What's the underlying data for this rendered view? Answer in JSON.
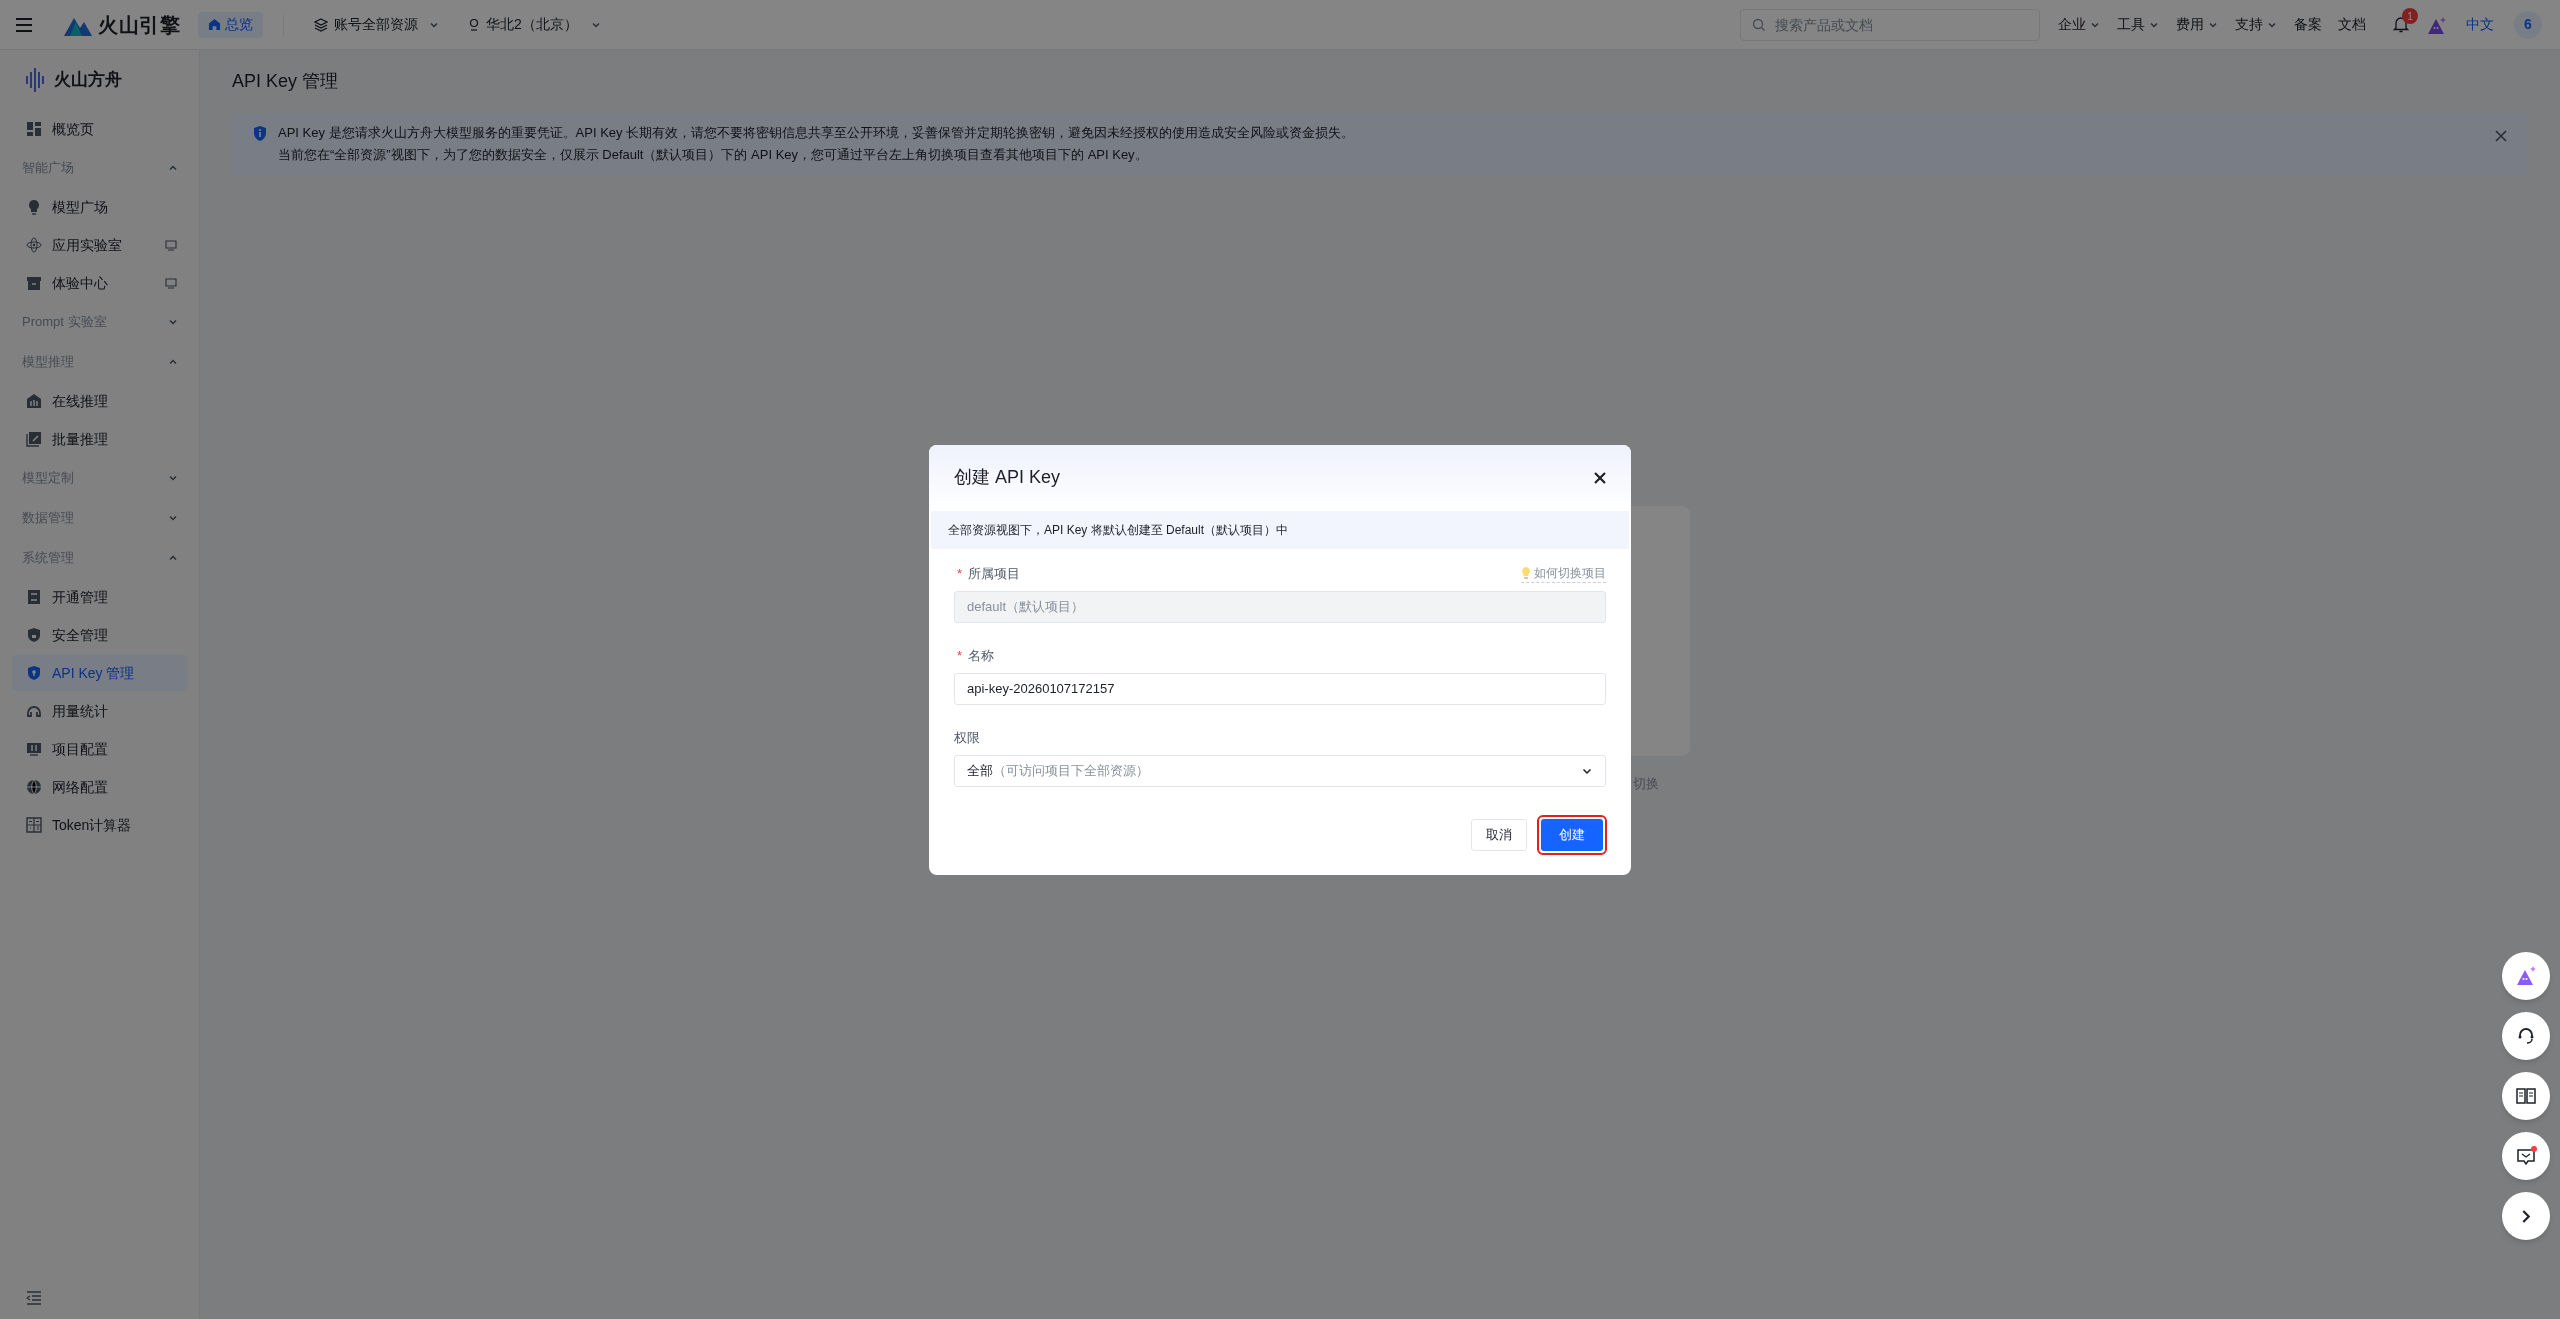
{
  "top_bar": {
    "logo_text": "火山引擎",
    "home_button": "总览",
    "account_selector": "账号全部资源",
    "region_selector": "华北2（北京）",
    "search": {
      "placeholder": "搜索产品或文档"
    },
    "menus": [
      {
        "label": "企业",
        "kind": "dropdown"
      },
      {
        "label": "工具",
        "kind": "dropdown"
      },
      {
        "label": "费用",
        "kind": "dropdown"
      },
      {
        "label": "支持",
        "kind": "dropdown"
      },
      {
        "label": "备案",
        "kind": "link"
      },
      {
        "label": "文档",
        "kind": "link"
      }
    ],
    "notification_count": "1",
    "language": "中文",
    "avatar": "6"
  },
  "sidebar": {
    "brand": "火山方舟",
    "items": [
      {
        "kind": "link",
        "label": "概览页",
        "selected": false,
        "monitor": false
      },
      {
        "kind": "group",
        "label": "智能广场",
        "expanded": true,
        "children": [
          {
            "label": "模型广场",
            "selected": false,
            "monitor": false
          },
          {
            "label": "应用实验室",
            "selected": false,
            "monitor": true
          },
          {
            "label": "体验中心",
            "selected": false,
            "monitor": true
          }
        ]
      },
      {
        "kind": "group",
        "label": "Prompt 实验室",
        "expanded": false
      },
      {
        "kind": "group",
        "label": "模型推理",
        "expanded": true,
        "children": [
          {
            "label": "在线推理",
            "selected": false,
            "monitor": false
          },
          {
            "label": "批量推理",
            "selected": false,
            "monitor": false
          }
        ]
      },
      {
        "kind": "group",
        "label": "模型定制",
        "expanded": false
      },
      {
        "kind": "group",
        "label": "数据管理",
        "expanded": false
      },
      {
        "kind": "group",
        "label": "系统管理",
        "expanded": true,
        "children": [
          {
            "label": "开通管理",
            "selected": false,
            "monitor": false
          },
          {
            "label": "安全管理",
            "selected": false,
            "monitor": false
          },
          {
            "label": "API Key 管理",
            "selected": true,
            "monitor": false
          },
          {
            "label": "用量统计",
            "selected": false,
            "monitor": false
          },
          {
            "label": "项目配置",
            "selected": false,
            "monitor": false
          },
          {
            "label": "网络配置",
            "selected": false,
            "monitor": false
          },
          {
            "label": "Token计算器",
            "selected": false,
            "monitor": false
          }
        ]
      }
    ]
  },
  "page": {
    "title": "API Key 管理",
    "banner": {
      "lines": [
        "API Key 是您请求火山方舟大模型服务的重要凭证。API Key 长期有效，请您不要将密钥信息共享至公开环境，妥善保管并定期轮换密钥，避免因未经授权的使用造成安全风险或资金损失。",
        "当前您在“全部资源”视图下，为了您的数据安全，仅展示 Default（默认项目）下的 API Key，您可通过平台左上角切换项目查看其他项目下的 API Key。"
      ]
    },
    "hidden_text_fragment": "切换"
  },
  "dialog": {
    "title": "创建 API Key",
    "notice": "全部资源视图下，API Key 将默认创建至 Default（默认项目）中",
    "help_link": "如何切换项目",
    "fields": [
      {
        "label": "所属项目",
        "required_mark": "*",
        "kind": "readonly",
        "value": "default（默认项目）"
      },
      {
        "label": "名称",
        "required_mark": "*",
        "kind": "text",
        "value": "api-key-20260107172157"
      },
      {
        "label": "权限",
        "kind": "select",
        "value": "全部",
        "hint": "（可访问项目下全部资源）"
      }
    ],
    "cancel_button": "取消",
    "submit_button": {
      "label": "创建",
      "highlighted": true
    }
  }
}
